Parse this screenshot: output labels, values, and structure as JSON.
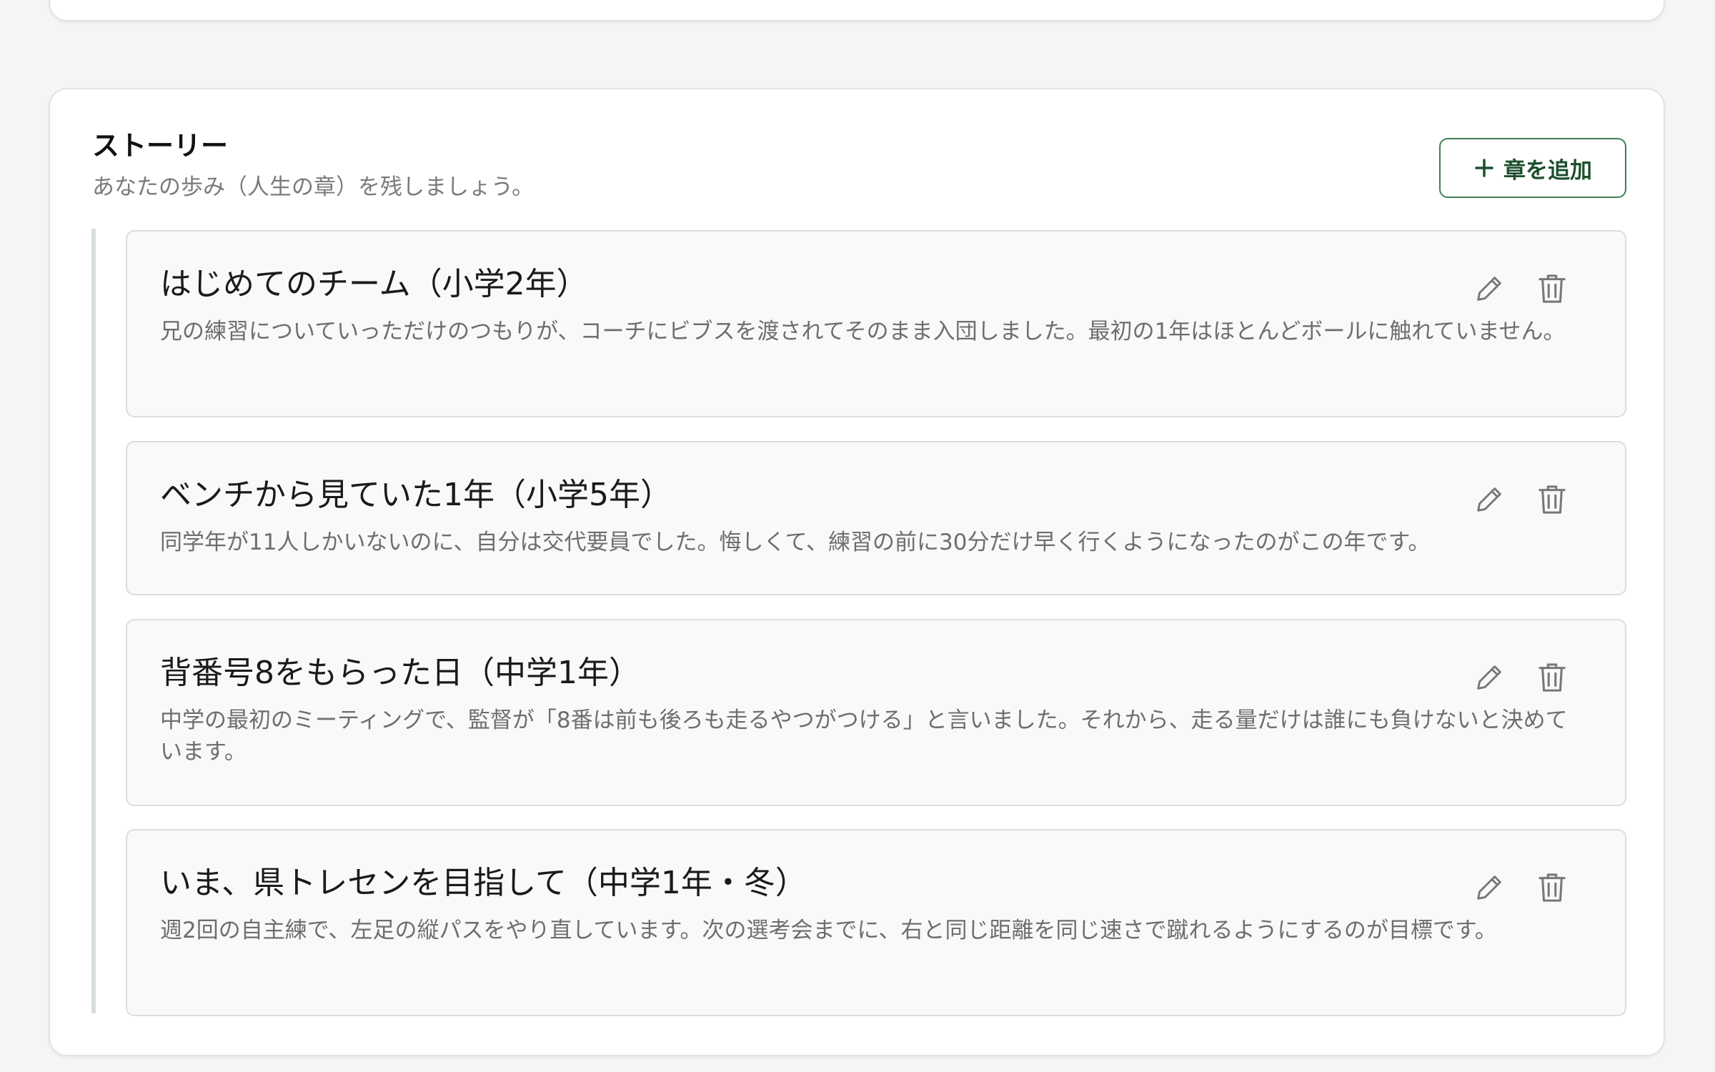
{
  "story": {
    "title": "ストーリー",
    "subtitle": "あなたの歩み（人生の章）を残しましょう。",
    "add_label": "章を追加",
    "accent_color": "#1d4f2e",
    "chapters": [
      {
        "title": "はじめてのチーム（小学2年）",
        "body": "兄の練習についていっただけのつもりが、コーチにビブスを渡されてそのまま入団しました。最初の1年はほとんどボールに触れていません。"
      },
      {
        "title": "ベンチから見ていた1年（小学5年）",
        "body": "同学年が11人しかいないのに、自分は交代要員でした。悔しくて、練習の前に30分だけ早く行くようになったのがこの年です。"
      },
      {
        "title": "背番号8をもらった日（中学1年）",
        "body": "中学の最初のミーティングで、監督が「8番は前も後ろも走るやつがつける」と言いました。それから、走る量だけは誰にも負けないと決めています。"
      },
      {
        "title": "いま、県トレセンを目指して（中学1年・冬）",
        "body": "週2回の自主練で、左足の縦パスをやり直しています。次の選考会までに、右と同じ距離を同じ速さで蹴れるようにするのが目標です。"
      }
    ]
  },
  "icons": {
    "add": "plus-icon",
    "edit": "pencil-icon",
    "delete": "trash-icon"
  }
}
